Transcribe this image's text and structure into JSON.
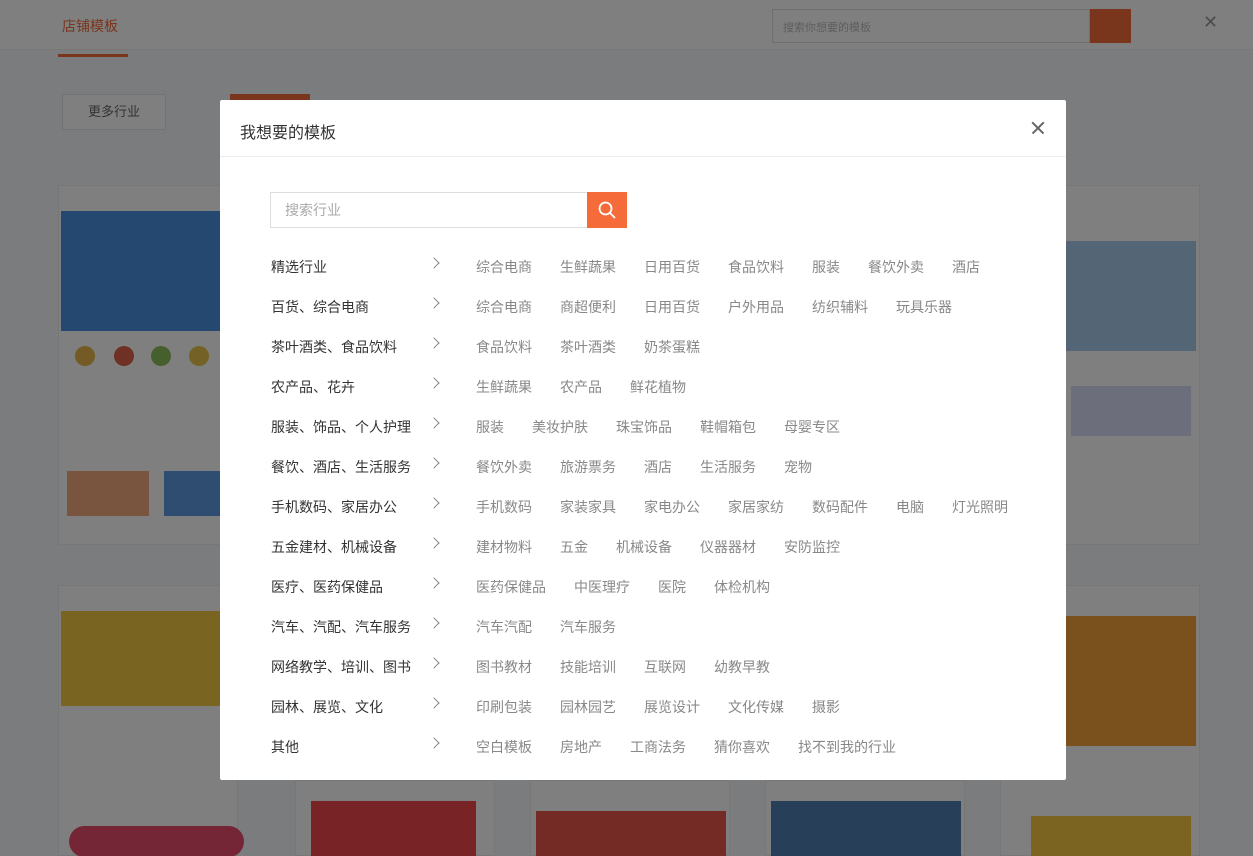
{
  "background": {
    "logo": "店铺模板",
    "search_placeholder": "搜索你想要的模板",
    "filter_label": "更多行业"
  },
  "modal": {
    "title": "我想要的模板",
    "search": {
      "placeholder": "搜索行业"
    },
    "categories": [
      {
        "label": "精选行业",
        "items": [
          "综合电商",
          "生鲜蔬果",
          "日用百货",
          "食品饮料",
          "服装",
          "餐饮外卖",
          "酒店"
        ]
      },
      {
        "label": "百货、综合电商",
        "items": [
          "综合电商",
          "商超便利",
          "日用百货",
          "户外用品",
          "纺织辅料",
          "玩具乐器"
        ]
      },
      {
        "label": "茶叶酒类、食品饮料",
        "items": [
          "食品饮料",
          "茶叶酒类",
          "奶茶蛋糕"
        ]
      },
      {
        "label": "农产品、花卉",
        "items": [
          "生鲜蔬果",
          "农产品",
          "鲜花植物"
        ]
      },
      {
        "label": "服装、饰品、个人护理",
        "items": [
          "服装",
          "美妆护肤",
          "珠宝饰品",
          "鞋帽箱包",
          "母婴专区"
        ]
      },
      {
        "label": "餐饮、酒店、生活服务",
        "items": [
          "餐饮外卖",
          "旅游票务",
          "酒店",
          "生活服务",
          "宠物"
        ]
      },
      {
        "label": "手机数码、家居办公",
        "items": [
          "手机数码",
          "家装家具",
          "家电办公",
          "家居家纺",
          "数码配件",
          "电脑",
          "灯光照明"
        ]
      },
      {
        "label": "五金建材、机械设备",
        "items": [
          "建材物料",
          "五金",
          "机械设备",
          "仪器器材",
          "安防监控"
        ]
      },
      {
        "label": "医疗、医药保健品",
        "items": [
          "医药保健品",
          "中医理疗",
          "医院",
          "体检机构"
        ]
      },
      {
        "label": "汽车、汽配、汽车服务",
        "items": [
          "汽车汽配",
          "汽车服务"
        ]
      },
      {
        "label": "网络教学、培训、图书",
        "items": [
          "图书教材",
          "技能培训",
          "互联网",
          "幼教早教"
        ]
      },
      {
        "label": "园林、展览、文化",
        "items": [
          "印刷包装",
          "园林园艺",
          "展览设计",
          "文化传媒",
          "摄影"
        ]
      },
      {
        "label": "其他",
        "items": [
          "空白模板",
          "房地产",
          "工商法务",
          "猜你喜欢",
          "找不到我的行业"
        ]
      }
    ]
  },
  "colors": {
    "accent": "#f56b3a",
    "overlay": "rgba(0,0,0,0.5)"
  },
  "icons": {
    "search": "search-icon",
    "close": "close-icon",
    "chevron": "chevron-right-icon"
  }
}
